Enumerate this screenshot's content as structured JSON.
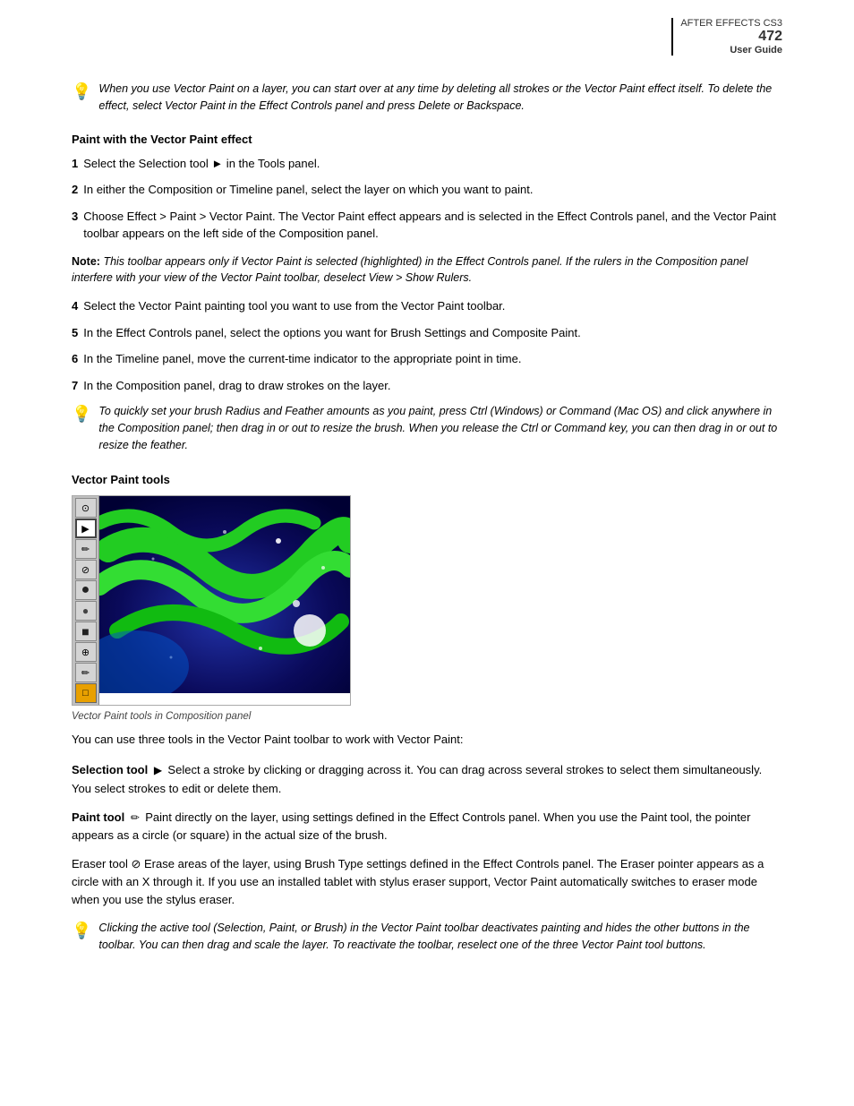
{
  "header": {
    "product": "AFTER EFFECTS CS3",
    "page_num": "472",
    "guide": "User Guide"
  },
  "tip1": {
    "text": "When you use Vector Paint on a layer, you can start over at any time by deleting all strokes or the Vector Paint effect itself. To delete the effect, select Vector Paint in the Effect Controls panel and press Delete or Backspace."
  },
  "paint_with_vector": {
    "title": "Paint with the Vector Paint effect",
    "steps": [
      {
        "num": "1",
        "text": "Select the Selection tool ► in the Tools panel."
      },
      {
        "num": "2",
        "text": "In either the Composition or Timeline panel, select the layer on which you want to paint."
      },
      {
        "num": "3",
        "text": "Choose Effect > Paint > Vector Paint. The Vector Paint effect appears and is selected in the Effect Controls panel, and the Vector Paint toolbar appears on the left side of the Composition panel."
      },
      {
        "num": "4",
        "text": "Select the Vector Paint painting tool you want to use from the Vector Paint toolbar."
      },
      {
        "num": "5",
        "text": "In the Effect Controls panel, select the options you want for Brush Settings and Composite Paint."
      },
      {
        "num": "6",
        "text": "In the Timeline panel, move the current-time indicator to the appropriate point in time."
      },
      {
        "num": "7",
        "text": "In the Composition panel, drag to draw strokes on the layer."
      }
    ],
    "note": "Note: This toolbar appears only if Vector Paint is selected (highlighted) in the Effect Controls panel. If the rulers in the Composition panel interfere with your view of the Vector Paint toolbar, deselect View > Show Rulers."
  },
  "tip2": {
    "text": "To quickly set your brush Radius and Feather amounts as you paint, press Ctrl (Windows) or Command (Mac OS) and click anywhere in the Composition panel; then drag in or out to resize the brush. When you release the Ctrl or Command key, you can then drag in or out to resize the feather."
  },
  "vector_paint_tools": {
    "title": "Vector Paint tools",
    "caption": "Vector Paint tools in Composition panel",
    "toolbar_buttons": [
      "⊙",
      "▶",
      "✏",
      "⊘",
      "●",
      "●",
      "■",
      "⊕",
      "✏",
      "□"
    ]
  },
  "paragraph_intro": "You can use three tools in the Vector Paint toolbar to work with Vector Paint:",
  "tools": {
    "selection": {
      "name": "Selection tool",
      "icon": "▶",
      "description": "Select a stroke by clicking or dragging across it. You can drag across several strokes to select them simultaneously. You select strokes to edit or delete them."
    },
    "paint": {
      "name": "Paint tool",
      "icon": "✏",
      "description": "Paint directly on the layer, using settings defined in the Effect Controls panel. When you use the Paint tool, the pointer appears as a circle (or square) in the actual size of the brush."
    },
    "eraser": {
      "name": "Eraser tool",
      "icon": "⊘",
      "description": "Erase areas of the layer, using Brush Type settings defined in the Effect Controls panel. The Eraser pointer appears as a circle with an X through it. If you use an installed tablet with stylus eraser support, Vector Paint automatically switches to eraser mode when you use the stylus eraser."
    }
  },
  "tip3": {
    "text": "Clicking the active tool (Selection, Paint, or Brush) in the Vector Paint toolbar deactivates painting and hides the other buttons in the toolbar. You can then drag and scale the layer. To reactivate the toolbar, reselect one of the three Vector Paint tool buttons."
  }
}
